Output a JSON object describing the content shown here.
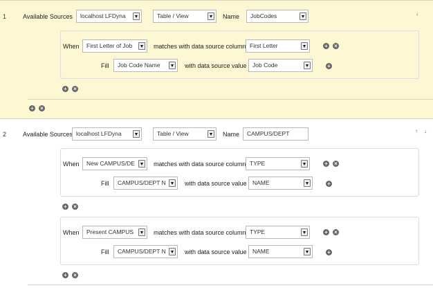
{
  "rows": [
    {
      "number": "1",
      "available_sources_label": "Available Sources",
      "source": "localhost LFDyna",
      "object_type": "Table / View",
      "name_label": "Name",
      "name": "JobCodes",
      "arrows": [
        "↓"
      ],
      "conditions": [
        {
          "when_label": "When",
          "when_field": "First Letter of Job",
          "matches_label": "matches with data source column",
          "match_column": "First Letter",
          "fill_label": "Fill",
          "fill_field": "Job Code Name",
          "value_label": "with data source value",
          "value_column": "Job Code"
        }
      ]
    },
    {
      "number": "2",
      "available_sources_label": "Available Sources",
      "source": "localhost LFDyna",
      "object_type": "Table / View",
      "name_label": "Name",
      "name": "CAMPUS/DEPT",
      "arrows": [
        "↑",
        "↓"
      ],
      "conditions": [
        {
          "when_label": "When",
          "when_field": "New CAMPUS/DE",
          "matches_label": "matches with data source column",
          "match_column": "TYPE",
          "fill_label": "Fill",
          "fill_field": "CAMPUS/DEPT N",
          "value_label": "with data source value",
          "value_column": "NAME"
        },
        {
          "when_label": "When",
          "when_field": "Present CAMPUS",
          "matches_label": "matches with data source column",
          "match_column": "TYPE",
          "fill_label": "Fill",
          "fill_field": "CAMPUS/DEPT N",
          "value_label": "with data source value",
          "value_column": "NAME"
        }
      ]
    }
  ],
  "icons": {
    "add": "+",
    "remove": "×"
  }
}
